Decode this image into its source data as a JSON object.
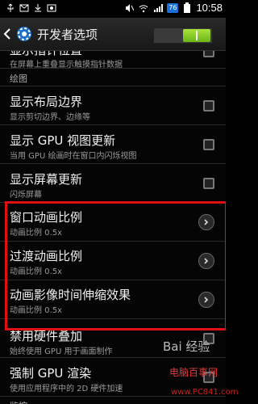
{
  "status": {
    "battery": "76",
    "time": "10:58",
    "icons": [
      "usb-icon",
      "mail-icon",
      "download-icon",
      "photo-icon",
      "mute-icon",
      "wifi-icon",
      "signal-icon",
      "battery-icon"
    ]
  },
  "header": {
    "title": "开发者选项",
    "back_icon": "back-caret-icon",
    "app_icon": "gear-icon"
  },
  "list": {
    "partial_top": {
      "title": "显示指针位置",
      "subtitle": "在屏幕上重叠显示触摸指针数据"
    },
    "section_drawing": "绘图",
    "items": [
      {
        "title": "显示布局边界",
        "subtitle": "显示剪切边界、边缘等",
        "control": "checkbox"
      },
      {
        "title": "显示 GPU 视图更新",
        "subtitle": "当用 GPU 绘画时在窗口内闪烁视图",
        "control": "checkbox"
      },
      {
        "title": "显示屏幕更新",
        "subtitle": "闪烁屏幕",
        "control": "checkbox"
      },
      {
        "title": "窗口动画比例",
        "subtitle": "动画比例 0.5x",
        "control": "chevron"
      },
      {
        "title": "过渡动画比例",
        "subtitle": "动画比例 0.5x",
        "control": "chevron"
      },
      {
        "title": "动画影像时间伸缩效果",
        "subtitle": "动画比例 0.5x",
        "control": "chevron"
      },
      {
        "title": "禁用硬件叠加",
        "subtitle": "始终使用 GPU 用于画面制作",
        "control": "checkbox"
      },
      {
        "title": "强制 GPU 渲染",
        "subtitle": "使用应用程序中的 2D 硬件加速",
        "control": "checkbox"
      }
    ],
    "section_monitor": "监控"
  },
  "watermark": {
    "brand": "Bai 经验",
    "site": "电脑百事网",
    "url": "www.PC841.com"
  },
  "colors": {
    "highlight": "#e01010",
    "toggle_on": "#8fd12e"
  }
}
